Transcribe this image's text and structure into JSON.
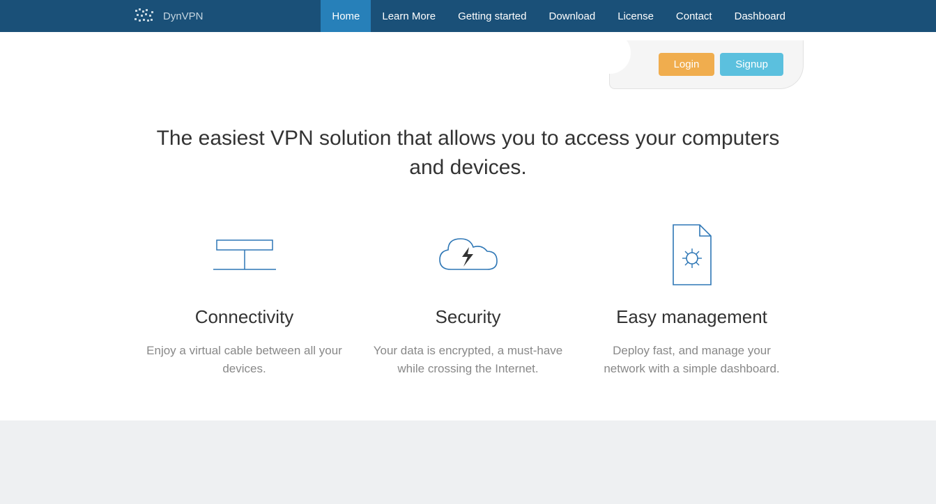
{
  "brand": {
    "name": "DynVPN"
  },
  "nav": {
    "items": [
      {
        "label": "Home",
        "active": true
      },
      {
        "label": "Learn More",
        "active": false
      },
      {
        "label": "Getting started",
        "active": false
      },
      {
        "label": "Download",
        "active": false
      },
      {
        "label": "License",
        "active": false
      },
      {
        "label": "Contact",
        "active": false
      },
      {
        "label": "Dashboard",
        "active": false
      }
    ]
  },
  "auth": {
    "login_label": "Login",
    "signup_label": "Signup"
  },
  "hero": {
    "headline": "The easiest VPN solution that allows you to access your computers and devices."
  },
  "features": [
    {
      "title": "Connectivity",
      "description": "Enjoy a virtual cable between all your devices.",
      "icon": "network-icon"
    },
    {
      "title": "Security",
      "description": "Your data is encrypted, a must-have while crossing the Internet.",
      "icon": "cloud-bolt-icon"
    },
    {
      "title": "Easy management",
      "description": "Deploy fast, and manage your network with a simple dashboard.",
      "icon": "file-gear-icon"
    }
  ],
  "colors": {
    "navbar": "#1a5078",
    "active_nav": "#2780b9",
    "login_btn": "#f0ad4e",
    "signup_btn": "#5bc0de",
    "icon_stroke": "#2d76b5"
  }
}
